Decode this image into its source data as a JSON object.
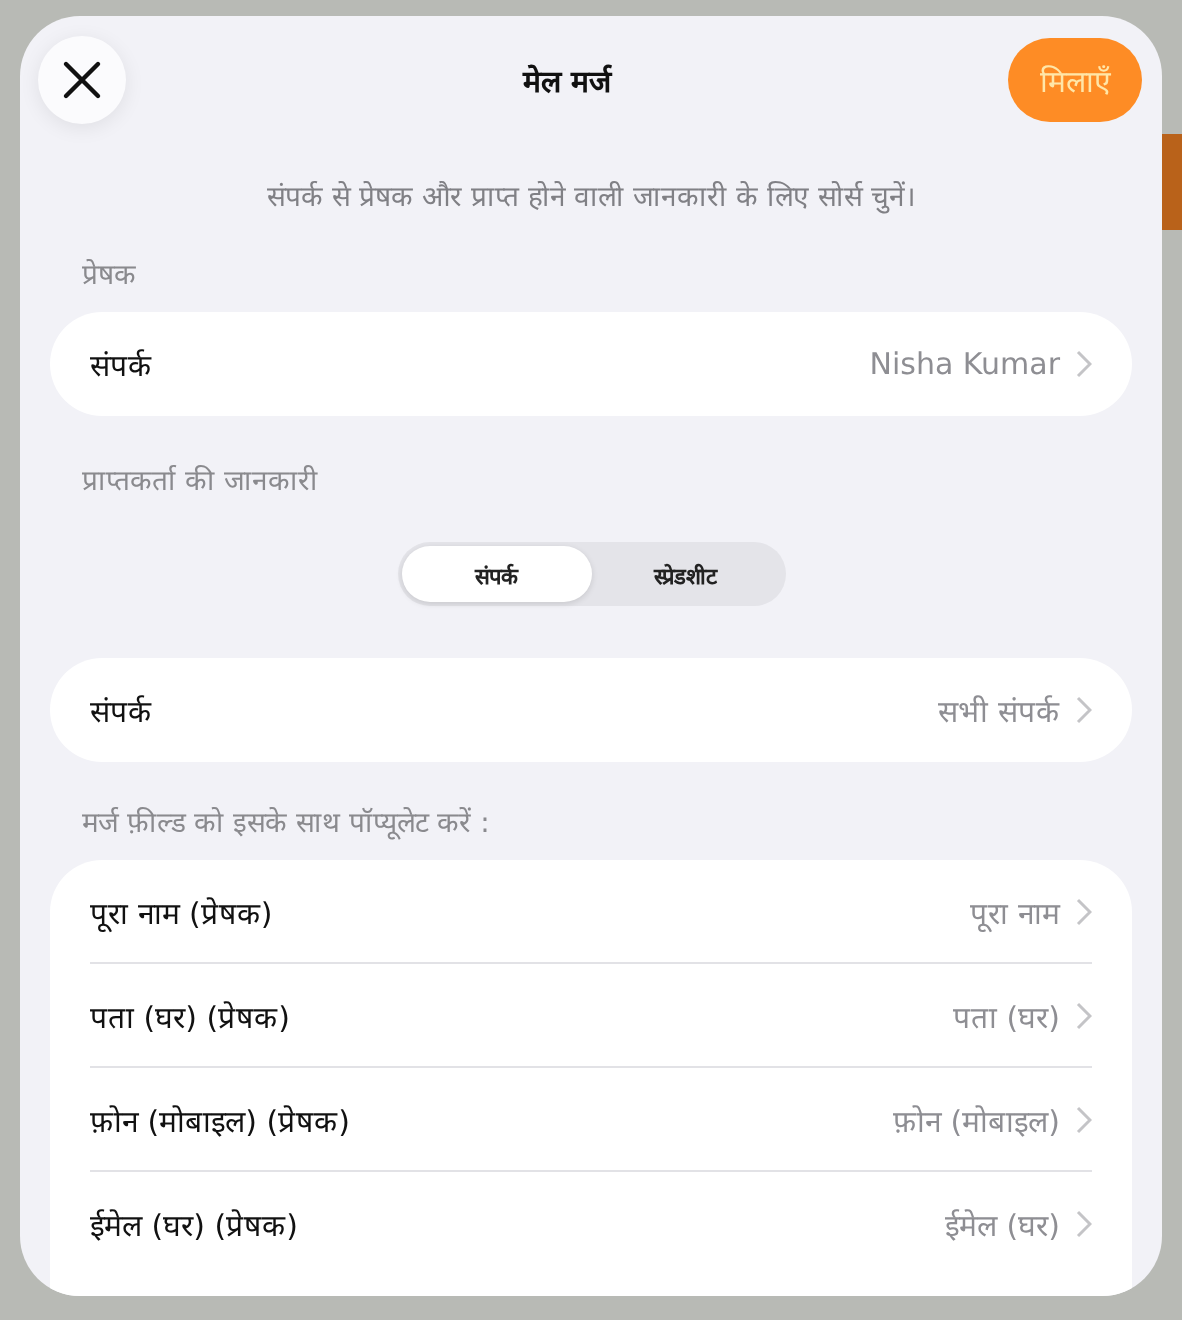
{
  "dialog": {
    "title": "मेल मर्ज",
    "confirm_button": "मिलाएँ",
    "description": "संपर्क से प्रेषक और प्राप्त होने वाली जानकारी के लिए सोर्स चुनें।"
  },
  "sender": {
    "heading": "प्रेषक",
    "label": "संपर्क",
    "value": "Nisha Kumar"
  },
  "recipient": {
    "heading": "प्राप्तकर्ता की जानकारी",
    "segments": [
      {
        "label": "संपर्क",
        "selected": true
      },
      {
        "label": "स्प्रेडशीट",
        "selected": false
      }
    ],
    "label": "संपर्क",
    "value": "सभी संपर्क"
  },
  "fields": {
    "heading": "मर्ज फ़ील्ड को इसके साथ पॉप्यूलेट करें :",
    "rows": [
      {
        "label": "पूरा नाम (प्रेषक)",
        "value": "पूरा नाम"
      },
      {
        "label": "पता (घर) (प्रेषक)",
        "value": "पता (घर)"
      },
      {
        "label": "फ़ोन (मोबाइल) (प्रेषक)",
        "value": "फ़ोन (मोबाइल)"
      },
      {
        "label": "ईमेल (घर) (प्रेषक)",
        "value": "ईमेल (घर)"
      }
    ]
  }
}
